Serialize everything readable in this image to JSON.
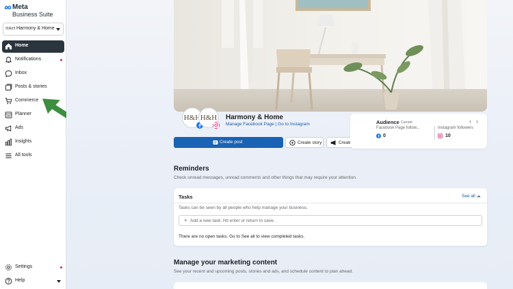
{
  "sidebar": {
    "brand": {
      "line1": "Meta",
      "line2": "Business Suite"
    },
    "account": {
      "logo_text": "H&H",
      "name": "Harmony & Home"
    },
    "items": [
      {
        "label": "Home",
        "icon": "home-icon",
        "active": true
      },
      {
        "label": "Notifications",
        "icon": "bell-icon",
        "dot": true
      },
      {
        "label": "Inbox",
        "icon": "chat-bubble-icon"
      },
      {
        "label": "Posts & stories",
        "icon": "posts-icon"
      },
      {
        "label": "Commerce",
        "icon": "cart-icon"
      },
      {
        "label": "Planner",
        "icon": "calendar-icon"
      },
      {
        "label": "Ads",
        "icon": "megaphone-icon"
      },
      {
        "label": "Insights",
        "icon": "bar-chart-icon"
      },
      {
        "label": "All tools",
        "icon": "menu-icon"
      }
    ],
    "footer_items": [
      {
        "label": "Settings",
        "icon": "gear-icon",
        "dot": true
      },
      {
        "label": "Help",
        "icon": "question-icon",
        "caret": true
      }
    ]
  },
  "colors": {
    "primary": "#1a62b3",
    "active_nav": "#2b353e",
    "link": "#1a5aa8",
    "notification_dot": "#e41e3f",
    "annotation_arrow": "#3e8e41"
  },
  "profile": {
    "name": "Harmony & Home",
    "avatar_text": "H&H",
    "link_facebook": "Manage Facebook Page",
    "link_separator": "|",
    "link_instagram": "Go to Instagram"
  },
  "actions": {
    "create_post": "Create post",
    "create_story": "Create story",
    "create_ad": "Create ad"
  },
  "audience": {
    "title": "Audience",
    "tag": "Current",
    "facebook_label": "Facebook Page follow...",
    "facebook_count": "0",
    "instagram_label": "Instagram followers",
    "instagram_count": "10"
  },
  "reminders": {
    "title": "Reminders",
    "subtitle": "Check unread messages, unread comments and other things that may require your attention."
  },
  "tasks": {
    "title": "Tasks",
    "see_all": "See all",
    "description": "Tasks can be seen by all people who help manage your business.",
    "input_placeholder": "Add a new task. Hit enter or return to save.",
    "empty_text": "There are no open tasks. Go to See all to view completed tasks."
  },
  "marketing": {
    "title": "Manage your marketing content",
    "subtitle": "See your recent and upcoming posts, stories and ads, and schedule content to plan ahead."
  }
}
